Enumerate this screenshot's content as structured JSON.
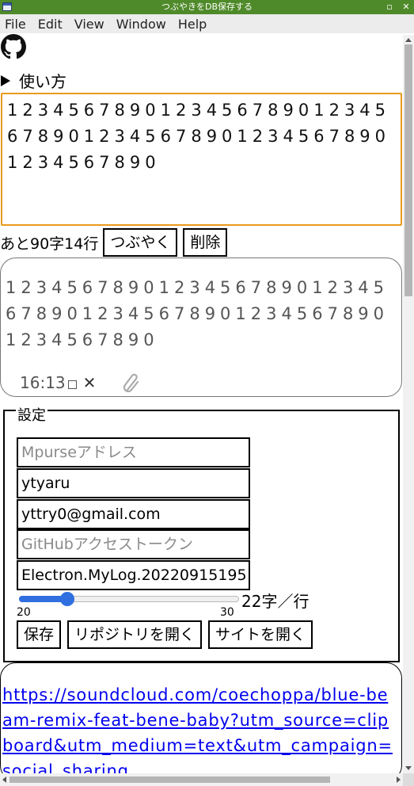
{
  "window": {
    "title": "つぶやきをDB保存する",
    "controls": [
      "▫",
      "✕"
    ]
  },
  "menu": [
    "File",
    "Edit",
    "View",
    "Window",
    "Help"
  ],
  "howto": {
    "label": "使い方"
  },
  "editor": {
    "text": "123456789012345678901234567890123456789012345678901234567890"
  },
  "status": {
    "remaining": "あと90字14行",
    "tweet_button": "つぶやく",
    "delete_button": "削除"
  },
  "post": {
    "text": "123456789012345678901234567890123456789012345678901234567890",
    "time": "16:13",
    "delete_mark": "✕"
  },
  "settings": {
    "legend": "設定",
    "mpurse": {
      "value": "",
      "placeholder": "Mpurseアドレス"
    },
    "username": {
      "value": "ytyaru"
    },
    "email": {
      "value": "yttry0@gmail.com"
    },
    "github_token": {
      "value": "",
      "placeholder": "GitHubアクセストークン"
    },
    "repo": {
      "value": "Electron.MyLog.20220915195"
    },
    "slider": {
      "min": "20",
      "max": "30",
      "value": 22,
      "readout": "22字／行"
    },
    "save_button": "保存",
    "open_repo_button": "リポジトリを開く",
    "open_site_button": "サイトを開く"
  },
  "link": {
    "url": "https://soundcloud.com/coechoppa/blue-beam-remix-feat-bene-baby?utm_source=clipboard&utm_medium=text&utm_campaign=social_sharing"
  },
  "colors": {
    "titlebar": "#4f8a2a",
    "focus_border": "#e89a1c",
    "slider_accent": "#2f6fe0",
    "link": "#0000ee"
  },
  "icons": {
    "github": "github-icon",
    "clip": "paperclip-icon"
  }
}
